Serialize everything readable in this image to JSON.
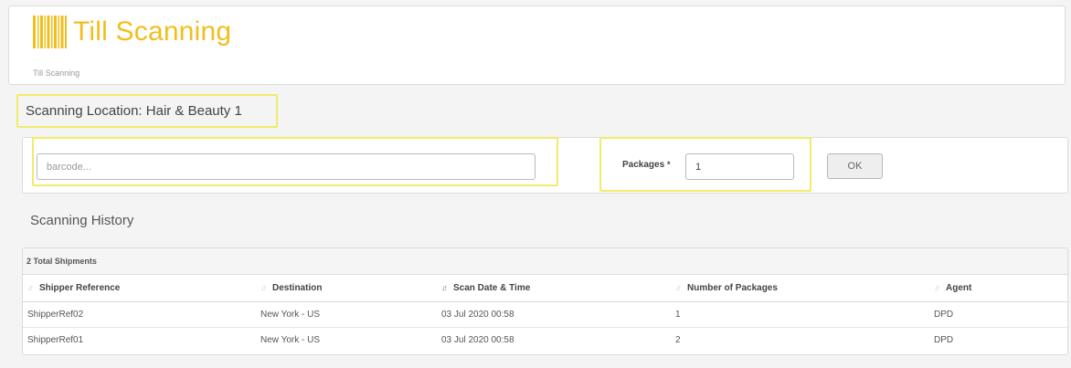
{
  "header": {
    "app_title": "Till Scanning",
    "breadcrumb": "Till Scanning",
    "logo_icon": "barcode-icon",
    "accent_color": "#f0bf1f"
  },
  "location": {
    "label": "Scanning Location: Hair & Beauty 1"
  },
  "scan_form": {
    "barcode_placeholder": "barcode...",
    "barcode_value": "",
    "packages_label": "Packages",
    "packages_required_mark": "*",
    "packages_value": "1",
    "ok_label": "OK"
  },
  "history": {
    "title": "Scanning History",
    "total_label": "2 Total Shipments",
    "columns": [
      "Shipper Reference",
      "Destination",
      "Scan Date & Time",
      "Number of Packages",
      "Agent"
    ],
    "rows": [
      [
        "ShipperRef02",
        "New York - US",
        "03 Jul 2020 00:58",
        "1",
        "DPD"
      ],
      [
        "ShipperRef01",
        "New York - US",
        "03 Jul 2020 00:58",
        "2",
        "DPD"
      ]
    ]
  }
}
